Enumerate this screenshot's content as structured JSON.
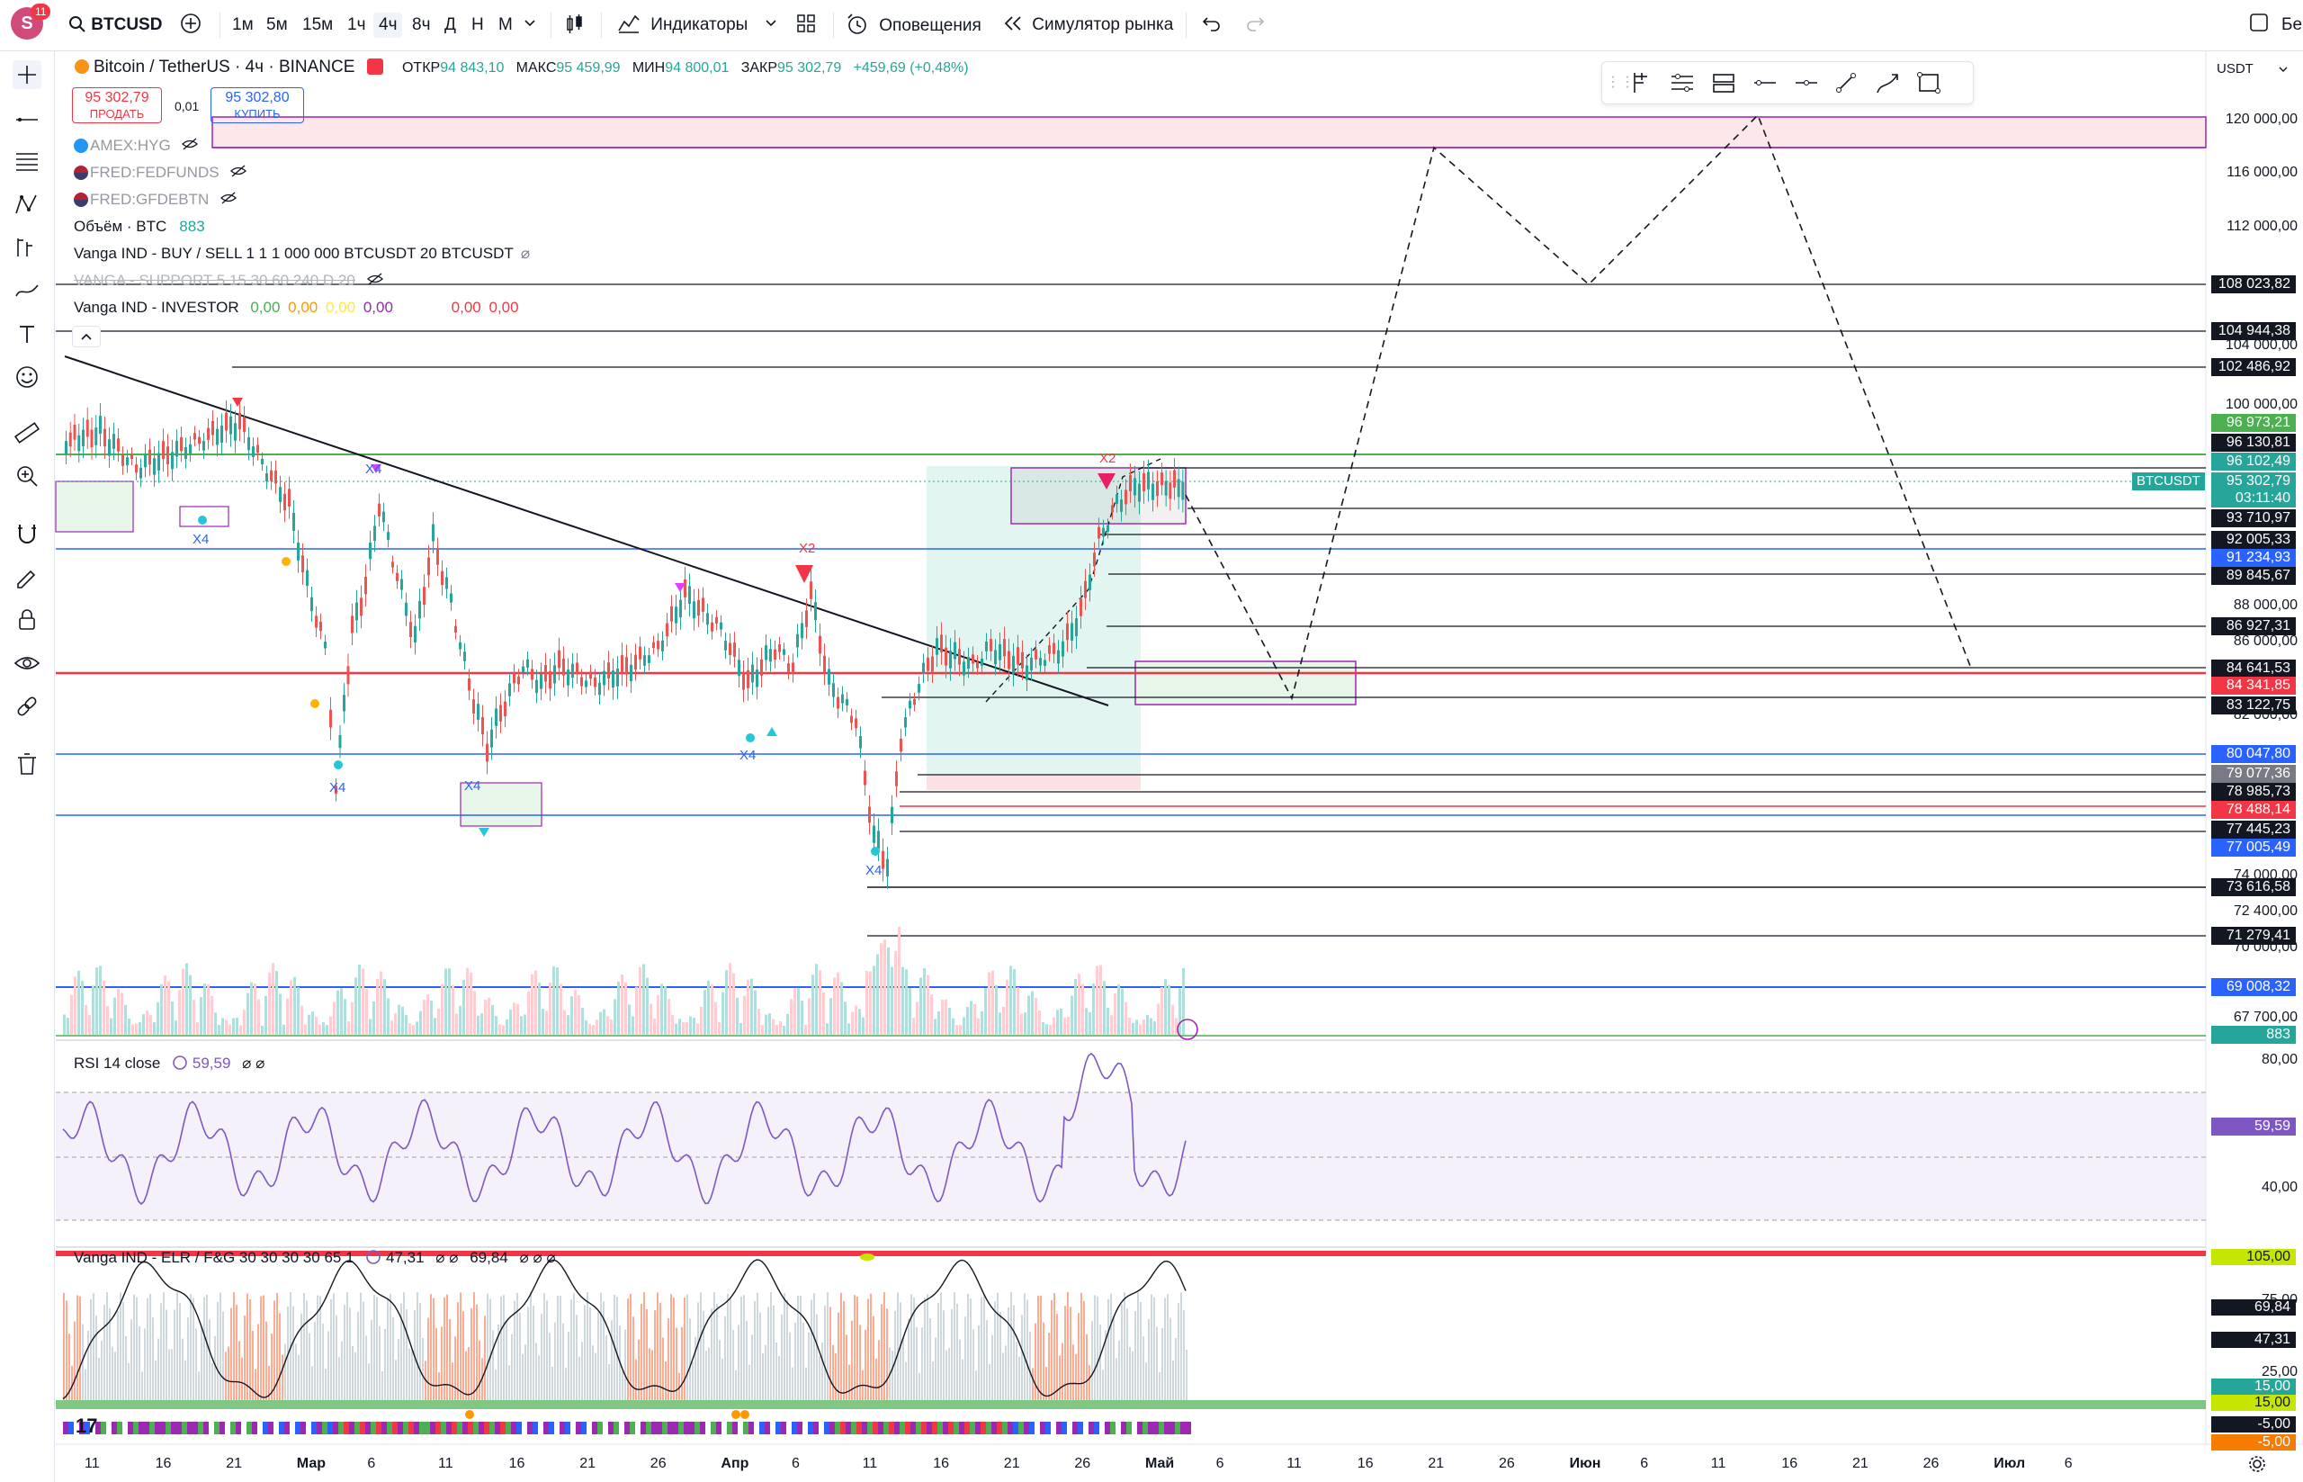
{
  "topbar": {
    "avatar_letter": "S",
    "avatar_badge": "11",
    "symbol": "BTCUSD",
    "intervals": [
      "1м",
      "5м",
      "15м",
      "1ч",
      "4ч",
      "8ч",
      "Д",
      "Н",
      "М"
    ],
    "active_interval": "4ч",
    "indicators_label": "Индикаторы",
    "alerts_label": "Оповещения",
    "replay_label": "Симулятор рынка",
    "right_text": "Бе"
  },
  "legend": {
    "title": "Bitcoin / TetherUS · 4ч · BINANCE",
    "open_label": "ОТКР",
    "open_value": "94 843,10",
    "high_label": "МАКС",
    "high_value": "95 459,99",
    "low_label": "МИН",
    "low_value": "94 800,01",
    "close_label": "ЗАКР",
    "close_value": "95 302,79",
    "change": "+459,69 (+0,48%)",
    "sell_price": "95 302,79",
    "sell_label": "ПРОДАТЬ",
    "spread": "0,01",
    "buy_price": "95 302,80",
    "buy_label": "КУПИТЬ",
    "overlays": [
      "AMEX:HYG",
      "FRED:FEDFUNDS",
      "FRED:GFDEBTN"
    ],
    "volume_label": "Объём · BTC",
    "volume_value": "883",
    "ind1": "Vanga IND - BUY / SELL 1 1 1 000 000 BTCUSDT 20 BTCUSDT",
    "ind2": "VANGA - SUPPORT 5 15 30 60 240 D 20",
    "ind3_label": "Vanga IND - INVESTOR",
    "ind3_values": [
      "0,00",
      "0,00",
      "0,00",
      "0,00",
      "0,00",
      "0,00"
    ]
  },
  "currency": "USDT",
  "price_axis_ticks": [
    "120 000,00",
    "116 000,00",
    "112 000,00",
    "104 000,00",
    "100 000,00",
    "88 000,00",
    "86 000,00",
    "82 000,00",
    "74 000,00",
    "72 400,00",
    "70 000,00",
    "67 700,00"
  ],
  "price_labels": [
    {
      "text": "108 023,82",
      "color": "#131722"
    },
    {
      "text": "104 944,38",
      "color": "#131722"
    },
    {
      "text": "102 486,92",
      "color": "#131722"
    },
    {
      "text": "96 973,21",
      "color": "#4caf50"
    },
    {
      "text": "96 130,81",
      "color": "#131722"
    },
    {
      "text": "96 102,49",
      "color": "#26a69a"
    },
    {
      "text": "95 302,79",
      "color": "#26a69a"
    },
    {
      "text": "03:11:40",
      "color": "#26a69a"
    },
    {
      "text": "93 710,97",
      "color": "#131722"
    },
    {
      "text": "92 005,33",
      "color": "#131722"
    },
    {
      "text": "91 234,93",
      "color": "#2962ff"
    },
    {
      "text": "89 845,67",
      "color": "#131722"
    },
    {
      "text": "86 927,31",
      "color": "#131722"
    },
    {
      "text": "84 641,53",
      "color": "#131722"
    },
    {
      "text": "84 341,85",
      "color": "#f23645"
    },
    {
      "text": "83 122,75",
      "color": "#131722"
    },
    {
      "text": "80 047,80",
      "color": "#2962ff"
    },
    {
      "text": "79 077,36",
      "color": "#787b86"
    },
    {
      "text": "78 985,73",
      "color": "#131722"
    },
    {
      "text": "78 488,14",
      "color": "#f23645"
    },
    {
      "text": "77 445,23",
      "color": "#131722"
    },
    {
      "text": "77 005,49",
      "color": "#2962ff"
    },
    {
      "text": "73 616,58",
      "color": "#131722"
    },
    {
      "text": "71 279,41",
      "color": "#131722"
    },
    {
      "text": "69 008,32",
      "color": "#2962ff"
    },
    {
      "text": "883",
      "color": "#26a69a"
    }
  ],
  "symbol_tag": "BTCUSDT",
  "rsi": {
    "label": "RSI 14 close",
    "value": "59,59",
    "ticks": [
      "80,00",
      "40,00"
    ],
    "value_label": "59,59"
  },
  "elr": {
    "label": "Vanga IND - ELR / F&G 30 30 30 30 65 1",
    "v1": "47,31",
    "v2": "69,84",
    "labels": [
      {
        "text": "105,00",
        "color": "#c6e600"
      },
      {
        "text": "69,84",
        "color": "#131722"
      },
      {
        "text": "47,31",
        "color": "#131722"
      },
      {
        "text": "15,00",
        "color": "#26a69a"
      },
      {
        "text": "15,00",
        "color": "#c6e600"
      },
      {
        "text": "-5,00",
        "color": "#131722"
      },
      {
        "text": "-5,00",
        "color": "#f57c00"
      }
    ],
    "ticks": [
      "75,00",
      "25,00"
    ]
  },
  "time_axis": [
    "11",
    "16",
    "21",
    "Мар",
    "6",
    "11",
    "16",
    "21",
    "26",
    "Апр",
    "6",
    "11",
    "16",
    "21",
    "26",
    "Май",
    "6",
    "11",
    "16",
    "21",
    "26",
    "Июн",
    "6",
    "11",
    "16",
    "21",
    "26",
    "Июл",
    "6"
  ],
  "chart_markers": [
    "X4",
    "X4",
    "X4",
    "X4",
    "X4",
    "X4",
    "X2",
    "X2"
  ]
}
